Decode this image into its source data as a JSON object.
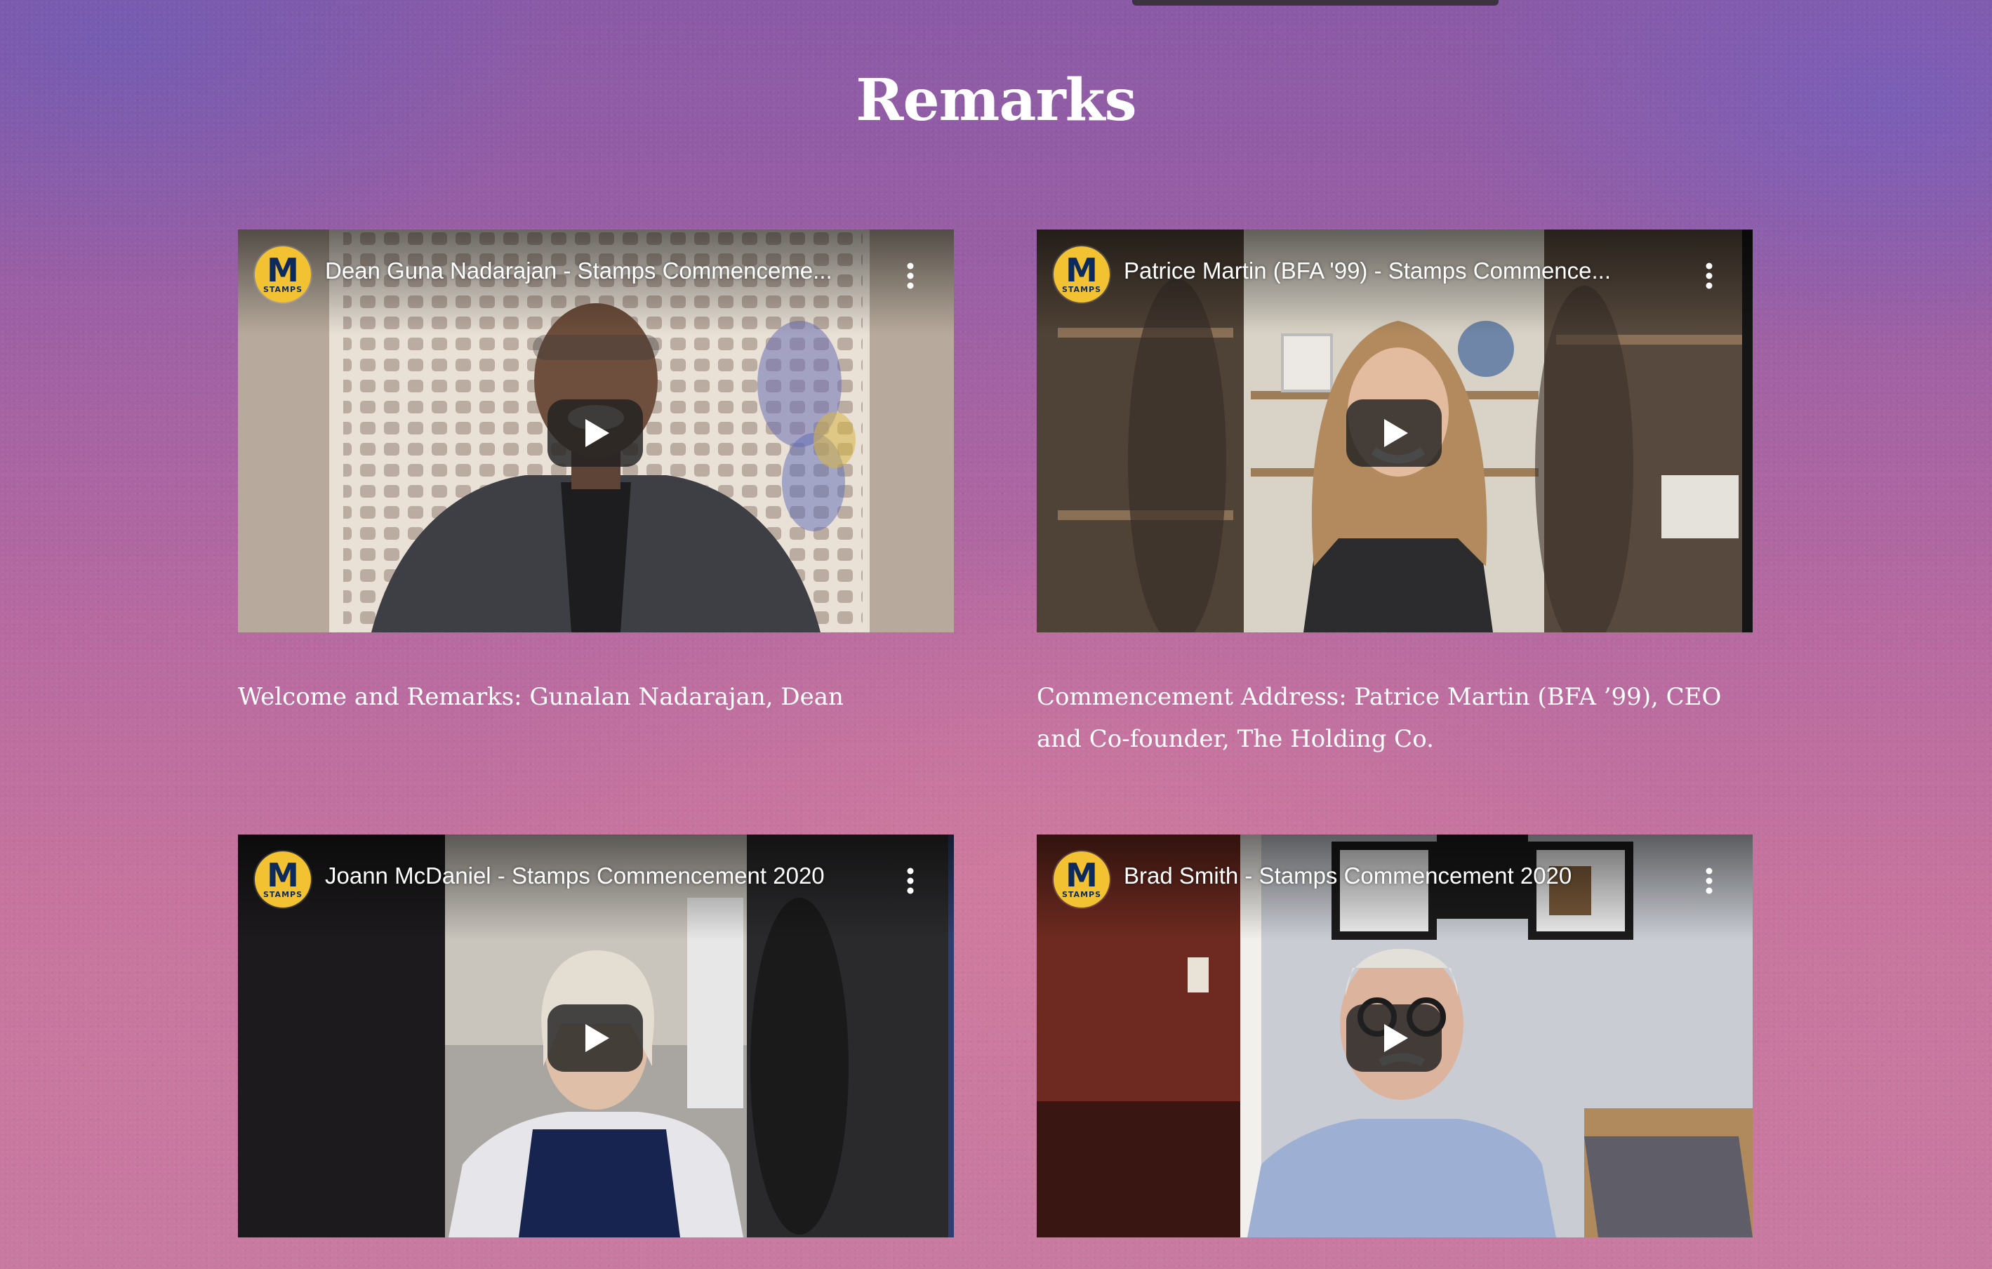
{
  "section": {
    "title": "Remarks"
  },
  "channel": {
    "logo_letter": "M",
    "logo_sub": "STAMPS"
  },
  "videos": [
    {
      "title": "Dean Guna Nadarajan - Stamps Commenceme...",
      "caption": "Welcome and Remarks: Gunalan Nadarajan, Dean"
    },
    {
      "title": "Patrice Martin (BFA '99) - Stamps Commence...",
      "caption": "Commencement Address: Patrice Martin (BFA ’99), CEO and Co-founder, The Holding Co."
    },
    {
      "title": "Joann McDaniel - Stamps Commencement 2020",
      "caption": ""
    },
    {
      "title": "Brad Smith - Stamps Commencement 2020",
      "caption": ""
    }
  ],
  "icons": {
    "play": "play-icon",
    "more": "more-vertical-icon"
  },
  "colors": {
    "play_button": "#212121",
    "logo_yellow": "#f3c232",
    "logo_navy": "#0d2a5c",
    "title_text": "#ffffff"
  }
}
